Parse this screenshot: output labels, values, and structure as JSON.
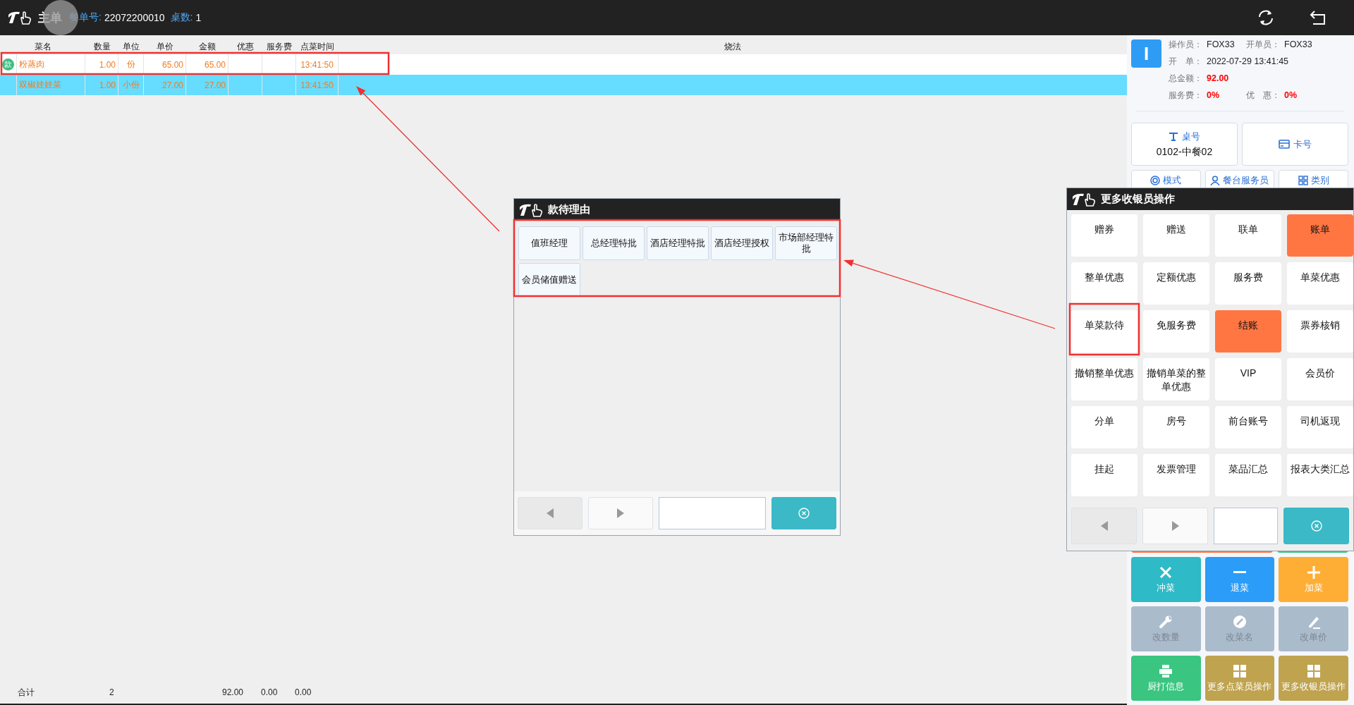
{
  "header": {
    "title": "主单",
    "order_label": "餐单号:",
    "order_number": "22072200010",
    "tables_label": "桌数:",
    "tables_count": "1"
  },
  "table": {
    "columns": [
      "菜名",
      "数量",
      "单位",
      "单价",
      "金额",
      "优惠",
      "服务费",
      "点菜时间",
      "烧法"
    ],
    "rows": [
      {
        "badge": "款",
        "name": "粉蒸肉",
        "qty": "1.00",
        "unit": "份",
        "price": "65.00",
        "amount": "65.00",
        "time": "13:41:50",
        "selected": false
      },
      {
        "name": "双椒娃娃菜",
        "qty": "1.00",
        "unit": "小份",
        "price": "27.00",
        "amount": "27.00",
        "time": "13:41:50",
        "selected": true
      }
    ],
    "totals": {
      "label": "合计",
      "qty": "2",
      "amount": "92.00",
      "discount": "0.00",
      "service": "0.00"
    }
  },
  "order_info": {
    "avatar": "I",
    "rows": [
      [
        {
          "label": "操作员：",
          "value": "FOX33"
        },
        {
          "label": "开单员：",
          "value": "FOX33"
        }
      ],
      [
        {
          "label": "开　单：",
          "value": "2022-07-29 13:41:45"
        }
      ],
      [
        {
          "label": "总金额：",
          "value": "92.00",
          "color": "#ff0000"
        }
      ],
      [
        {
          "label": "服务费：",
          "value": "0%",
          "color": "#ff0000"
        },
        {
          "label": "优　惠：",
          "value": "0%",
          "color": "#ff0000"
        }
      ]
    ]
  },
  "panel_buttons": [
    {
      "label": "桌号",
      "value": "0102-中餐02"
    },
    {
      "label": "卡号"
    }
  ],
  "panel_tabs": [
    "模式",
    "餐台服务员",
    "类别"
  ],
  "actions": [
    {
      "label": "冲菜",
      "color": "#2ebac6",
      "disabled": false
    },
    {
      "label": "退菜",
      "color": "#2b9cf8",
      "disabled": false
    },
    {
      "label": "加菜",
      "color": "#ffae35",
      "disabled": false
    },
    {
      "label": "改数量",
      "color": "#aabbcc",
      "disabled": true
    },
    {
      "label": "改菜名",
      "color": "#aabbcc",
      "disabled": true
    },
    {
      "label": "改单价",
      "color": "#aabbcc",
      "disabled": true
    },
    {
      "label": "厨打信息",
      "color": "#3ac580",
      "disabled": false
    },
    {
      "label": "更多点菜员操作",
      "color": "#bfa34f",
      "disabled": false
    },
    {
      "label": "更多收银员操作",
      "color": "#bfa34f",
      "disabled": false
    }
  ],
  "reason_dialog": {
    "title": "款待理由",
    "reasons": [
      "值班经理",
      "总经理特批",
      "酒店经理特批",
      "酒店经理授权",
      "市场部经理特批",
      "会员储值赠送"
    ]
  },
  "cashier_dialog": {
    "title": "更多收银员操作",
    "buttons": [
      {
        "label": "赠券",
        "kind": "normal"
      },
      {
        "label": "赠送",
        "kind": "normal"
      },
      {
        "label": "联单",
        "kind": "normal"
      },
      {
        "label": "账单",
        "kind": "accent"
      },
      {
        "label": "整单优惠",
        "kind": "normal"
      },
      {
        "label": "定额优惠",
        "kind": "normal"
      },
      {
        "label": "服务费",
        "kind": "normal"
      },
      {
        "label": "单菜优惠",
        "kind": "normal"
      },
      {
        "label": "单菜款待",
        "kind": "normal"
      },
      {
        "label": "免服务费",
        "kind": "normal"
      },
      {
        "label": "结账",
        "kind": "accent"
      },
      {
        "label": "票券核销",
        "kind": "normal"
      },
      {
        "label": "撤销整单优惠",
        "kind": "normal"
      },
      {
        "label": "撤销单菜的整单优惠",
        "kind": "normal"
      },
      {
        "label": "VIP",
        "kind": "normal"
      },
      {
        "label": "会员价",
        "kind": "normal"
      },
      {
        "label": "分单",
        "kind": "normal"
      },
      {
        "label": "房号",
        "kind": "normal"
      },
      {
        "label": "前台账号",
        "kind": "normal"
      },
      {
        "label": "司机返现",
        "kind": "normal"
      },
      {
        "label": "挂起",
        "kind": "normal"
      },
      {
        "label": "发票管理",
        "kind": "normal"
      },
      {
        "label": "菜品汇总",
        "kind": "normal"
      },
      {
        "label": "报表大类汇总",
        "kind": "normal"
      }
    ]
  }
}
